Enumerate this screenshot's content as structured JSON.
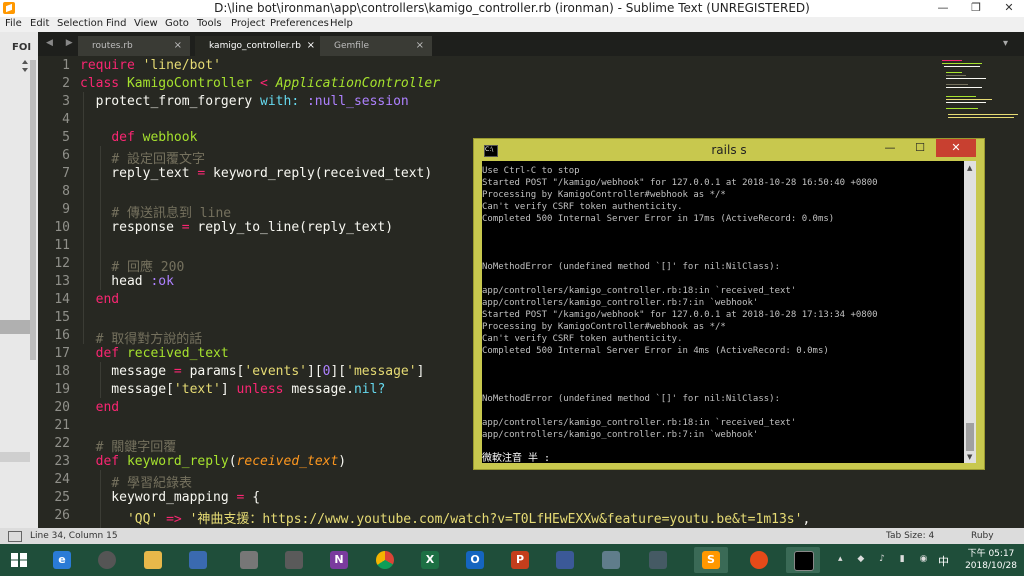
{
  "window": {
    "title": "D:\\line bot\\ironman\\app\\controllers\\kamigo_controller.rb (ironman) - Sublime Text (UNREGISTERED)",
    "controls": [
      "—",
      "❐",
      "✕"
    ]
  },
  "menu": [
    "File",
    "Edit",
    "Selection",
    "Find",
    "View",
    "Goto",
    "Tools",
    "Project",
    "Preferences",
    "Help"
  ],
  "sidebar": {
    "label": "FOI"
  },
  "tabs": [
    {
      "label": "routes.rb",
      "active": false
    },
    {
      "label": "kamigo_controller.rb",
      "active": true
    },
    {
      "label": "Gemfile",
      "active": false
    }
  ],
  "tab_close": "×",
  "tab_nav": "◀ ▶",
  "editor": {
    "line_numbers": [
      "1",
      "2",
      "3",
      "4",
      "5",
      "6",
      "7",
      "8",
      "9",
      "10",
      "11",
      "12",
      "13",
      "14",
      "15",
      "16",
      "17",
      "18",
      "19",
      "20",
      "21",
      "22",
      "23",
      "24",
      "25",
      "26"
    ]
  },
  "console": {
    "title": "rails s",
    "icon_text": "C:\\",
    "controls": [
      "—",
      "☐",
      "✕"
    ],
    "lines": [
      "Use Ctrl-C to stop",
      "Started POST \"/kamigo/webhook\" for 127.0.0.1 at 2018-10-28 16:50:40 +0800",
      "Processing by KamigoController#webhook as */*",
      "Can't verify CSRF token authenticity.",
      "Completed 500 Internal Server Error in 17ms (ActiveRecord: 0.0ms)",
      "",
      "",
      "",
      "NoMethodError (undefined method `[]' for nil:NilClass):",
      "",
      "app/controllers/kamigo_controller.rb:18:in `received_text'",
      "app/controllers/kamigo_controller.rb:7:in `webhook'",
      "Started POST \"/kamigo/webhook\" for 127.0.0.1 at 2018-10-28 17:13:34 +0800",
      "Processing by KamigoController#webhook as */*",
      "Can't verify CSRF token authenticity.",
      "Completed 500 Internal Server Error in 4ms (ActiveRecord: 0.0ms)",
      "",
      "",
      "",
      "NoMethodError (undefined method `[]' for nil:NilClass):",
      "",
      "app/controllers/kamigo_controller.rb:18:in `received_text'",
      "app/controllers/kamigo_controller.rb:7:in `webhook'"
    ],
    "ime": "微軟注音 半 :"
  },
  "status": {
    "position": "Line 34, Column 15",
    "tab_size": "Tab Size: 4",
    "syntax": "Ruby"
  },
  "taskbar": {
    "time": "下午 05:17",
    "date": "2018/10/28",
    "ime_indicator": "中",
    "app_letters": [
      "N",
      "X",
      "O",
      "P",
      "S"
    ]
  }
}
